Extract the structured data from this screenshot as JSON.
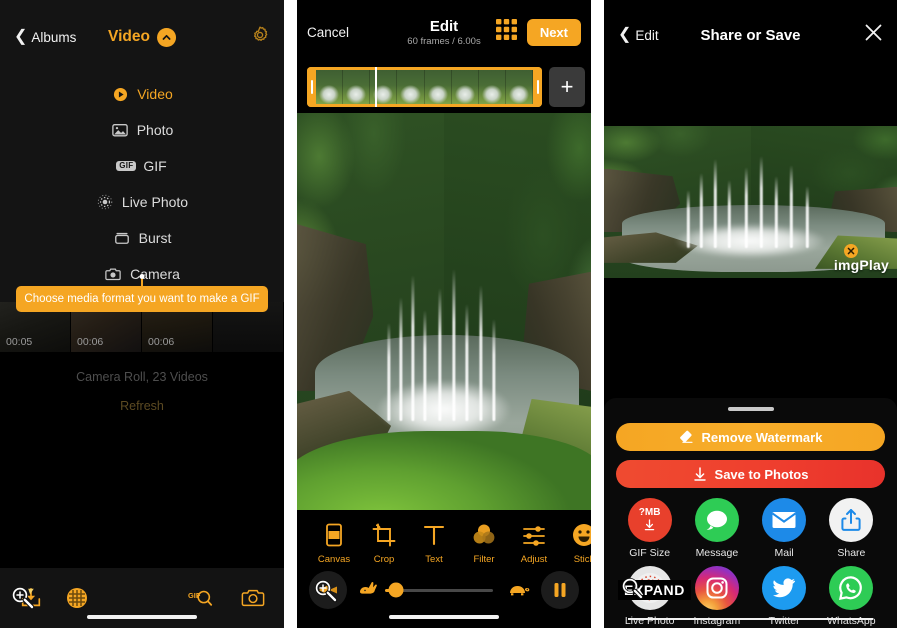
{
  "panel_albums": {
    "nav": {
      "back_label": "Albums",
      "title": "Video",
      "caret_icon": "chevron-up-icon",
      "gear_icon": "gear-icon"
    },
    "menu": [
      {
        "label": "Video",
        "icon": "play-circle-icon",
        "active": true
      },
      {
        "label": "Photo",
        "icon": "photo-icon",
        "active": false
      },
      {
        "label": "GIF",
        "icon": "gif-chip-icon",
        "active": false
      },
      {
        "label": "Live Photo",
        "icon": "live-photo-icon",
        "active": false
      },
      {
        "label": "Burst",
        "icon": "burst-icon",
        "active": false
      },
      {
        "label": "Camera",
        "icon": "camera-icon",
        "active": false
      }
    ],
    "tooltip": "Choose media format you want to make a GIF",
    "thumbnails": [
      {
        "duration": "00:05"
      },
      {
        "duration": "00:06"
      },
      {
        "duration": "00:06"
      },
      {
        "duration": ""
      }
    ],
    "library_status": "Camera Roll, 23 Videos",
    "refresh_label": "Refresh",
    "tabbar": [
      {
        "icon": "import-video-icon",
        "side": "left"
      },
      {
        "icon": "waffle-grid-icon",
        "side": "left"
      },
      {
        "icon": "gif-search-icon",
        "side": "right"
      },
      {
        "icon": "camera-capture-icon",
        "side": "right"
      }
    ]
  },
  "panel_edit": {
    "nav": {
      "cancel_label": "Cancel",
      "title": "Edit",
      "subtitle": "60 frames / 6.00s",
      "grid_icon": "grid-view-icon",
      "next_label": "Next"
    },
    "timeline": {
      "frame_count": 8,
      "add_label": "+",
      "playhead_percent": 29
    },
    "tools": [
      {
        "label": "Canvas",
        "icon": "canvas-icon"
      },
      {
        "label": "Crop",
        "icon": "crop-icon"
      },
      {
        "label": "Text",
        "icon": "text-icon"
      },
      {
        "label": "Filter",
        "icon": "filter-icon"
      },
      {
        "label": "Adjust",
        "icon": "adjust-icon"
      },
      {
        "label": "Stick",
        "icon": "sticker-icon"
      }
    ],
    "playback": {
      "direction_icon": "play-direction-icon",
      "fast_icon": "rabbit-icon",
      "slow_icon": "turtle-icon",
      "pause_icon": "pause-icon",
      "speed_percent": 3
    }
  },
  "panel_share": {
    "nav": {
      "back_label": "Edit",
      "title": "Share or Save",
      "close_icon": "close-icon"
    },
    "watermark": {
      "text": "imgPlay",
      "remove_badge_icon": "close-badge-icon"
    },
    "primary_buttons": [
      {
        "label": "Remove Watermark",
        "icon": "eraser-icon",
        "color": "#f5a623"
      },
      {
        "label": "Save to Photos",
        "icon": "download-icon",
        "color": "#ef4030"
      }
    ],
    "share_targets": [
      {
        "label": "GIF Size",
        "icon": "gif-size-icon",
        "badge": "?MB"
      },
      {
        "label": "Message",
        "icon": "message-icon"
      },
      {
        "label": "Mail",
        "icon": "mail-icon"
      },
      {
        "label": "Share",
        "icon": "share-up-icon"
      },
      {
        "label": "Live Photo",
        "icon": "live-photo-icon"
      },
      {
        "label": "Instagram",
        "icon": "instagram-icon"
      },
      {
        "label": "Twitter",
        "icon": "twitter-icon"
      },
      {
        "label": "WhatsApp",
        "icon": "whatsapp-icon"
      }
    ],
    "expand_overlay": "EXPAND"
  }
}
